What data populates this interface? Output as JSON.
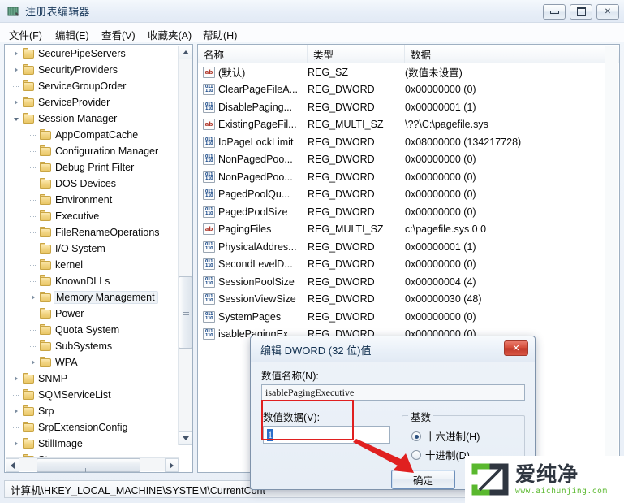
{
  "window": {
    "title": "注册表编辑器",
    "icon": "registry-editor-icon",
    "buttons": {
      "minimize": "",
      "maximize": "",
      "close": "✕"
    }
  },
  "menubar": {
    "items": [
      {
        "label": "文件(F)"
      },
      {
        "label": "编辑(E)"
      },
      {
        "label": "查看(V)"
      },
      {
        "label": "收藏夹(A)"
      },
      {
        "label": "帮助(H)"
      }
    ]
  },
  "tree": {
    "nodes": [
      {
        "label": "SecurePipeServers",
        "indent": 1,
        "twist": "closed",
        "selected": false
      },
      {
        "label": "SecurityProviders",
        "indent": 1,
        "twist": "closed",
        "selected": false
      },
      {
        "label": "ServiceGroupOrder",
        "indent": 1,
        "twist": "none",
        "selected": false
      },
      {
        "label": "ServiceProvider",
        "indent": 1,
        "twist": "closed",
        "selected": false
      },
      {
        "label": "Session Manager",
        "indent": 1,
        "twist": "expanded",
        "selected": false
      },
      {
        "label": "AppCompatCache",
        "indent": 2,
        "twist": "none",
        "selected": false
      },
      {
        "label": "Configuration Manager",
        "indent": 2,
        "twist": "none",
        "selected": false
      },
      {
        "label": "Debug Print Filter",
        "indent": 2,
        "twist": "none",
        "selected": false
      },
      {
        "label": "DOS Devices",
        "indent": 2,
        "twist": "none",
        "selected": false
      },
      {
        "label": "Environment",
        "indent": 2,
        "twist": "none",
        "selected": false
      },
      {
        "label": "Executive",
        "indent": 2,
        "twist": "none",
        "selected": false
      },
      {
        "label": "FileRenameOperations",
        "indent": 2,
        "twist": "none",
        "selected": false
      },
      {
        "label": "I/O System",
        "indent": 2,
        "twist": "none",
        "selected": false
      },
      {
        "label": "kernel",
        "indent": 2,
        "twist": "none",
        "selected": false
      },
      {
        "label": "KnownDLLs",
        "indent": 2,
        "twist": "none",
        "selected": false
      },
      {
        "label": "Memory Management",
        "indent": 2,
        "twist": "closed",
        "selected": true
      },
      {
        "label": "Power",
        "indent": 2,
        "twist": "none",
        "selected": false
      },
      {
        "label": "Quota System",
        "indent": 2,
        "twist": "none",
        "selected": false
      },
      {
        "label": "SubSystems",
        "indent": 2,
        "twist": "none",
        "selected": false
      },
      {
        "label": "WPA",
        "indent": 2,
        "twist": "closed",
        "selected": false
      },
      {
        "label": "SNMP",
        "indent": 1,
        "twist": "closed",
        "selected": false
      },
      {
        "label": "SQMServiceList",
        "indent": 1,
        "twist": "none",
        "selected": false
      },
      {
        "label": "Srp",
        "indent": 1,
        "twist": "closed",
        "selected": false
      },
      {
        "label": "SrpExtensionConfig",
        "indent": 1,
        "twist": "none",
        "selected": false
      },
      {
        "label": "StillImage",
        "indent": 1,
        "twist": "closed",
        "selected": false
      },
      {
        "label": "Storage",
        "indent": 1,
        "twist": "none",
        "selected": false
      }
    ]
  },
  "list": {
    "columns": [
      {
        "label": "名称",
        "key": "name"
      },
      {
        "label": "类型",
        "key": "type"
      },
      {
        "label": "数据",
        "key": "data"
      }
    ],
    "rows": [
      {
        "icon": "string-value-icon",
        "name": "(默认)",
        "type": "REG_SZ",
        "data": "(数值未设置)"
      },
      {
        "icon": "dword-value-icon",
        "name": "ClearPageFileA...",
        "type": "REG_DWORD",
        "data": "0x00000000 (0)"
      },
      {
        "icon": "dword-value-icon",
        "name": "DisablePaging...",
        "type": "REG_DWORD",
        "data": "0x00000001 (1)"
      },
      {
        "icon": "string-value-icon",
        "name": "ExistingPageFil...",
        "type": "REG_MULTI_SZ",
        "data": "\\??\\C:\\pagefile.sys"
      },
      {
        "icon": "dword-value-icon",
        "name": "IoPageLockLimit",
        "type": "REG_DWORD",
        "data": "0x08000000 (134217728)"
      },
      {
        "icon": "dword-value-icon",
        "name": "NonPagedPoo...",
        "type": "REG_DWORD",
        "data": "0x00000000 (0)"
      },
      {
        "icon": "dword-value-icon",
        "name": "NonPagedPoo...",
        "type": "REG_DWORD",
        "data": "0x00000000 (0)"
      },
      {
        "icon": "dword-value-icon",
        "name": "PagedPoolQu...",
        "type": "REG_DWORD",
        "data": "0x00000000 (0)"
      },
      {
        "icon": "dword-value-icon",
        "name": "PagedPoolSize",
        "type": "REG_DWORD",
        "data": "0x00000000 (0)"
      },
      {
        "icon": "string-value-icon",
        "name": "PagingFiles",
        "type": "REG_MULTI_SZ",
        "data": "c:\\pagefile.sys 0 0"
      },
      {
        "icon": "dword-value-icon",
        "name": "PhysicalAddres...",
        "type": "REG_DWORD",
        "data": "0x00000001 (1)"
      },
      {
        "icon": "dword-value-icon",
        "name": "SecondLevelD...",
        "type": "REG_DWORD",
        "data": "0x00000000 (0)"
      },
      {
        "icon": "dword-value-icon",
        "name": "SessionPoolSize",
        "type": "REG_DWORD",
        "data": "0x00000004 (4)"
      },
      {
        "icon": "dword-value-icon",
        "name": "SessionViewSize",
        "type": "REG_DWORD",
        "data": "0x00000030 (48)"
      },
      {
        "icon": "dword-value-icon",
        "name": "SystemPages",
        "type": "REG_DWORD",
        "data": "0x00000000 (0)"
      },
      {
        "icon": "dword-value-icon",
        "name": "isablePagingEx...",
        "type": "REG_DWORD",
        "data": "0x00000000 (0)"
      }
    ]
  },
  "statusbar": {
    "path": "计算机\\HKEY_LOCAL_MACHINE\\SYSTEM\\CurrentCont"
  },
  "dialog": {
    "title": "编辑 DWORD (32 位)值",
    "close_label": "✕",
    "value_name_label": "数值名称(N):",
    "value_name": "isablePagingExecutive",
    "value_data_label": "数值数据(V):",
    "value_data": "1",
    "base_group_label": "基数",
    "radios": [
      {
        "label": "十六进制(H)",
        "checked": true
      },
      {
        "label": "十进制(D)",
        "checked": false
      }
    ],
    "ok_label": "确定"
  },
  "watermark": {
    "brand": "爱纯净",
    "url": "www.aichunjing.com",
    "color": "#5ab82e"
  },
  "colors": {
    "annotation_red": "#e02020",
    "accent_blue": "#2a6fc9",
    "folder_yellow": "#f2d585"
  }
}
